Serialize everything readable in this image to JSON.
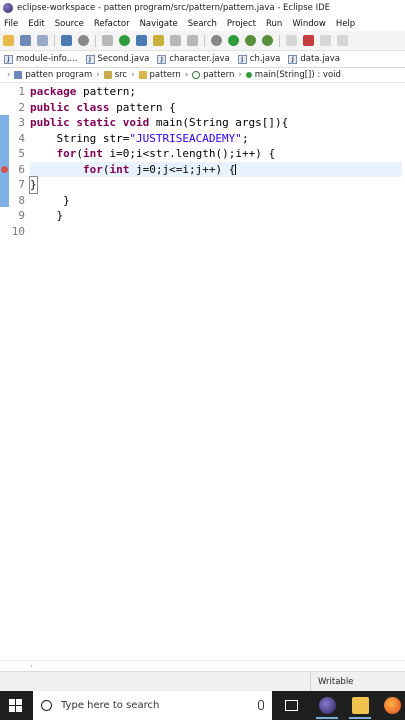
{
  "window": {
    "title": "eclipse-workspace - patten program/src/pattern/pattern.java - Eclipse IDE"
  },
  "menu": [
    "File",
    "Edit",
    "Source",
    "Refactor",
    "Navigate",
    "Search",
    "Project",
    "Run",
    "Window",
    "Help"
  ],
  "tabs": [
    {
      "label": "module-info...."
    },
    {
      "label": "Second.java"
    },
    {
      "label": "character.java"
    },
    {
      "label": "ch.java"
    },
    {
      "label": "data.java"
    }
  ],
  "breadcrumb": {
    "project": "patten program",
    "src": "src",
    "package": "pattern",
    "class": "pattern",
    "method": "main(String[]) : void"
  },
  "editor": {
    "line_numbers": [
      "1",
      "2",
      "3",
      "4",
      "5",
      "6",
      "7",
      "8",
      "9",
      "10"
    ],
    "lines": {
      "l1_kw": "package",
      "l1_rest": " pattern;",
      "l2_kw": "public class",
      "l2_rest": " pattern {",
      "l3_kw": "public static void",
      "l3_rest": " main(String args[]){",
      "l4_pre": "    String str=",
      "l4_str": "\"JUSTRISEACADEMY\"",
      "l4_post": ";",
      "l5_pre": "    ",
      "l5_kw": "for",
      "l5_mid": "(",
      "l5_kw2": "int",
      "l5_rest": " i=0;i<str.length();i++) {",
      "l6_pre": "        ",
      "l6_kw": "for",
      "l6_mid": "(",
      "l6_kw2": "int",
      "l6_rest": " j=0;j<=i;j++) {",
      "l7_text": "}",
      "l8_text": "     }",
      "l9_text": "    }",
      "l10_text": ""
    }
  },
  "status": {
    "writable": "Writable"
  },
  "taskbar": {
    "search_placeholder": "Type here to search"
  }
}
